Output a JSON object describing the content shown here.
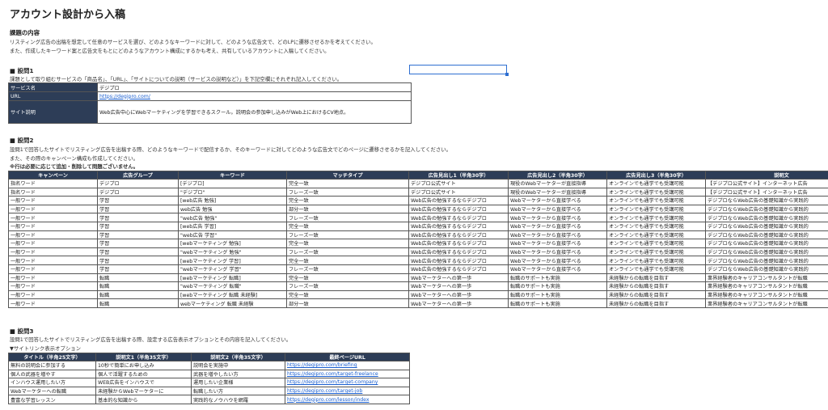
{
  "page": {
    "title": "アカウント設計から入稿",
    "task_heading": "課題の内容",
    "task_line1": "リスティング広告の出稿を想定して任意のサービスを選び、どのようなキーワードに対して、どのような広告文で、どのLPに遷移させるかを考えてください。",
    "task_line2": "また、作成したキーワード案と広告文をもとにどのようなアカウント構成にするかも考え、共有しているアカウントに入稿してください。"
  },
  "q1": {
    "heading": "■ 設問1",
    "desc": "課題として取り組むサービスの「商品名」、「URL」、「サイトについての説明（サービスの説明など）」を下記空欄にそれぞれ記入してください。",
    "rows": [
      {
        "label": "サービス名",
        "value": "デジプロ"
      },
      {
        "label": "URL",
        "value": "https://degipro.com/"
      },
      {
        "label": "サイト説明",
        "value": "Web広告中心にWebマーケティングを学習できるスクール。説明会の参加申し込みがWeb上におけるCV地点。"
      }
    ]
  },
  "q2": {
    "heading": "■ 設問2",
    "desc1": "設問1で回答したサイトでリスティング広告を出稿する際、どのようなキーワードで配信するか、そのキーワードに対してどのような広告文でどのページに遷移させるかを記入してください。",
    "desc2": "また、その際のキャンペーン構成も作成してください。",
    "note": "※行は必要に応じて追加・削除して問題ございません。",
    "headers": [
      "キャンペーン",
      "広告グループ",
      "キーワード",
      "マッチタイプ",
      "広告見出し1（半角30字）",
      "広告見出し2（半角30字）",
      "広告見出し3（半角30字）",
      "説明文"
    ],
    "rows": [
      [
        "指名ワード",
        "デジプロ",
        "[デジプロ]",
        "完全一致",
        "デジプロ公式サイト",
        "現役のWebマーケターが直接指導",
        "オンラインでも通学でも受講可能",
        "【デジプロ公式サイト】インターネット広告"
      ],
      [
        "指名ワード",
        "デジプロ",
        "\"デジプロ\"",
        "フレーズ一致",
        "デジプロ公式サイト",
        "現役のWebマーケターが直接指導",
        "オンラインでも通学でも受講可能",
        "【デジプロ公式サイト】インターネット広告"
      ],
      [
        "一般ワード",
        "学習",
        "[web広告 勉強]",
        "完全一致",
        "Web広告の勉強するならデジプロ",
        "Webマーケターから直接学べる",
        "オンラインでも通学でも受講可能",
        "デジプロならWeb広告の基礎知識から実践的"
      ],
      [
        "一般ワード",
        "学習",
        "web広告 勉強",
        "部分一致",
        "Web広告の勉強するならデジプロ",
        "Webマーケターから直接学べる",
        "オンラインでも通学でも受講可能",
        "デジプロならWeb広告の基礎知識から実践的"
      ],
      [
        "一般ワード",
        "学習",
        "\"web広告 勉強\"",
        "フレーズ一致",
        "Web広告の勉強するならデジプロ",
        "Webマーケターから直接学べる",
        "オンラインでも通学でも受講可能",
        "デジプロならWeb広告の基礎知識から実践的"
      ],
      [
        "一般ワード",
        "学習",
        "[web広告 学習]",
        "完全一致",
        "Web広告の勉強するならデジプロ",
        "Webマーケターから直接学べる",
        "オンラインでも通学でも受講可能",
        "デジプロならWeb広告の基礎知識から実践的"
      ],
      [
        "一般ワード",
        "学習",
        "\"web広告 学習\"",
        "フレーズ一致",
        "Web広告の勉強するならデジプロ",
        "Webマーケターから直接学べる",
        "オンラインでも通学でも受講可能",
        "デジプロならWeb広告の基礎知識から実践的"
      ],
      [
        "一般ワード",
        "学習",
        "[webマーケティング 勉強]",
        "完全一致",
        "Web広告の勉強するならデジプロ",
        "Webマーケターから直接学べる",
        "オンラインでも通学でも受講可能",
        "デジプロならWeb広告の基礎知識から実践的"
      ],
      [
        "一般ワード",
        "学習",
        "\"webマーケティング 勉強\"",
        "フレーズ一致",
        "Web広告の勉強するならデジプロ",
        "Webマーケターから直接学べる",
        "オンラインでも通学でも受講可能",
        "デジプロならWeb広告の基礎知識から実践的"
      ],
      [
        "一般ワード",
        "学習",
        "[webマーケティング 学習]",
        "完全一致",
        "Web広告の勉強するならデジプロ",
        "Webマーケターから直接学べる",
        "オンラインでも通学でも受講可能",
        "デジプロならWeb広告の基礎知識から実践的"
      ],
      [
        "一般ワード",
        "学習",
        "\"webマーケティング 学習\"",
        "フレーズ一致",
        "Web広告の勉強するならデジプロ",
        "Webマーケターから直接学べる",
        "オンラインでも通学でも受講可能",
        "デジプロならWeb広告の基礎知識から実践的"
      ],
      [
        "一般ワード",
        "転職",
        "[webマーケティング 転職]",
        "完全一致",
        "Webマーケターへの第一歩",
        "転職のサポートも実施",
        "未経験からの転職を目指す",
        "業界経験者のキャリアコンサルタントが転職"
      ],
      [
        "一般ワード",
        "転職",
        "\"webマーケティング 転職\"",
        "フレーズ一致",
        "Webマーケターへの第一歩",
        "転職のサポートも実施",
        "未経験からの転職を目指す",
        "業界経験者のキャリアコンサルタントが転職"
      ],
      [
        "一般ワード",
        "転職",
        "[webマーケティング 転職 未経験]",
        "完全一致",
        "Webマーケターへの第一歩",
        "転職のサポートも実施",
        "未経験からの転職を目指す",
        "業界経験者のキャリアコンサルタントが転職"
      ],
      [
        "一般ワード",
        "転職",
        "webマーケティング 転職 未経験",
        "部分一致",
        "Webマーケターへの第一歩",
        "転職のサポートも実施",
        "未経験からの転職を目指す",
        "業界経験者のキャリアコンサルタントが転職"
      ]
    ]
  },
  "q3": {
    "heading": "■ 設問3",
    "desc": "設問1で回答したサイトでリスティング広告を出稿する際、設定する広告表示オプションとその内容を記入してください。",
    "sub": "▼サイトリンク表示オプション",
    "headers": [
      "タイトル（半角25文字）",
      "説明文1（半角35文字）",
      "説明文2（半角35文字）",
      "最終ページURL"
    ],
    "rows": [
      [
        "無料の説明会に参加する",
        "10秒で簡単にお申し込み",
        "説明会を実施中",
        "https://degipro.com/briefing"
      ],
      [
        "個人の武器を増やす",
        "個人で活躍するための",
        "武器を増やしたい方",
        "https://degipro.com/target-freelance"
      ],
      [
        "インハウス運用したい方",
        "WEB広告をインハウスで",
        "運用したい企業様",
        "https://degipro.com/target-company"
      ],
      [
        "Webマーケターへの転職",
        "未経験からWebマーケターに",
        "転職したい方",
        "https://degipro.com/target-job"
      ],
      [
        "豊富な学習レッスン",
        "基本的な知識から",
        "実践的なノウハウを網羅",
        "https://degipro.com/lesson/index"
      ]
    ]
  }
}
